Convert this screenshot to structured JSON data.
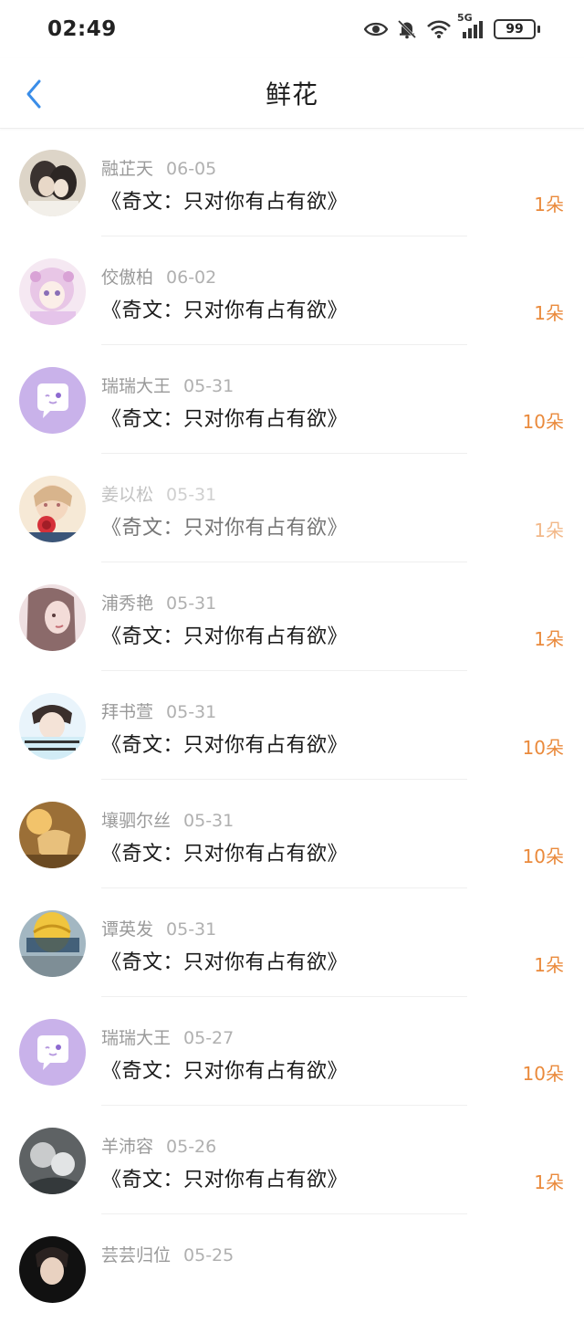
{
  "status": {
    "time": "02:49",
    "network": "5G",
    "battery": "99"
  },
  "header": {
    "title": "鲜花"
  },
  "colors": {
    "accent": "#3a8de8",
    "count": "#ea8a3c",
    "meta": "#9a9a9a"
  },
  "items": [
    {
      "name": "融芷天",
      "date": "06-05",
      "book": "《奇文：只对你有占有欲》",
      "count": "1朵",
      "avatar": "photo-couple"
    },
    {
      "name": "佼傲柏",
      "date": "06-02",
      "book": "《奇文：只对你有占有欲》",
      "count": "1朵",
      "avatar": "anime-girl"
    },
    {
      "name": "瑞瑞大王",
      "date": "05-31",
      "book": "《奇文：只对你有占有欲》",
      "count": "10朵",
      "avatar": "default-chat"
    },
    {
      "name": "姜以松",
      "date": "05-31",
      "book": "《奇文：只对你有占有欲》",
      "count": "1朵",
      "avatar": "illustration-rose"
    },
    {
      "name": "浦秀艳",
      "date": "05-31",
      "book": "《奇文：只对你有占有欲》",
      "count": "1朵",
      "avatar": "photo-girl"
    },
    {
      "name": "拜书萱",
      "date": "05-31",
      "book": "《奇文：只对你有占有欲》",
      "count": "10朵",
      "avatar": "photo-boy"
    },
    {
      "name": "壤驷尔丝",
      "date": "05-31",
      "book": "《奇文：只对你有占有欲》",
      "count": "10朵",
      "avatar": "photo-warm"
    },
    {
      "name": "谭英发",
      "date": "05-31",
      "book": "《奇文：只对你有占有欲》",
      "count": "1朵",
      "avatar": "photo-balloon"
    },
    {
      "name": "瑞瑞大王",
      "date": "05-27",
      "book": "《奇文：只对你有占有欲》",
      "count": "10朵",
      "avatar": "default-chat"
    },
    {
      "name": "羊沛容",
      "date": "05-26",
      "book": "《奇文：只对你有占有欲》",
      "count": "1朵",
      "avatar": "photo-gray"
    },
    {
      "name": "芸芸归位",
      "date": "05-25",
      "book": "",
      "count": "",
      "avatar": "photo-dark"
    }
  ]
}
